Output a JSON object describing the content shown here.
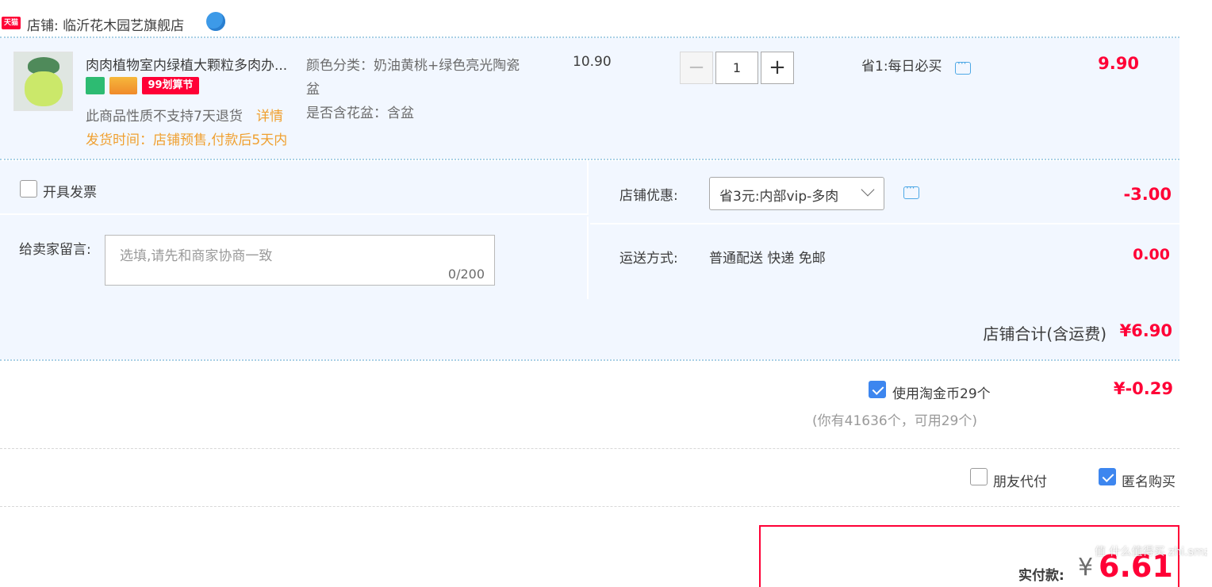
{
  "shop": {
    "badge": "天猫",
    "label": "店铺: 临沂花木园艺旗舰店"
  },
  "item": {
    "title": "肉肉植物室内绿植大颗粒多肉办...",
    "badge_99": "99划算节",
    "return_policy": "此商品性质不支持7天退货",
    "return_detail": "详情",
    "ship_time": "发货时间：店铺预售,付款后5天内",
    "sku_color": "颜色分类：奶油黄桃+绿色亮光陶瓷盆",
    "sku_pot": "是否含花盆：含盆",
    "unit_price": "10.90",
    "quantity": "1",
    "promo": "省1:每日必买",
    "subtotal": "9.90"
  },
  "invoice": {
    "label": "开具发票"
  },
  "message": {
    "label": "给卖家留言:",
    "placeholder": "选填,请先和商家协商一致",
    "count": "0/200"
  },
  "shop_discount": {
    "label": "店铺优惠:",
    "selected": "省3元:内部vip-多肉",
    "amount": "-3.00"
  },
  "shipping": {
    "label": "运送方式:",
    "method": "普通配送 快递 免邮",
    "amount": "0.00"
  },
  "shop_total": {
    "label": "店铺合计(含运费)",
    "amount": "¥6.90"
  },
  "coins": {
    "label": "使用淘金币29个",
    "note": "(你有41636个，可用29个)",
    "amount": "¥-0.29"
  },
  "options": {
    "friend_pay": "朋友代付",
    "anonymous": "匿名购买"
  },
  "pay": {
    "label": "实付款:",
    "currency": "¥",
    "amount": "6.61"
  },
  "watermark": "值 什么值得买 zhi.smzdm.com",
  "colors": {
    "accent_red": "#ff0036",
    "section_bg": "#f2f7ff",
    "orange": "#f0a030",
    "checkbox_blue": "#3d86ef"
  }
}
